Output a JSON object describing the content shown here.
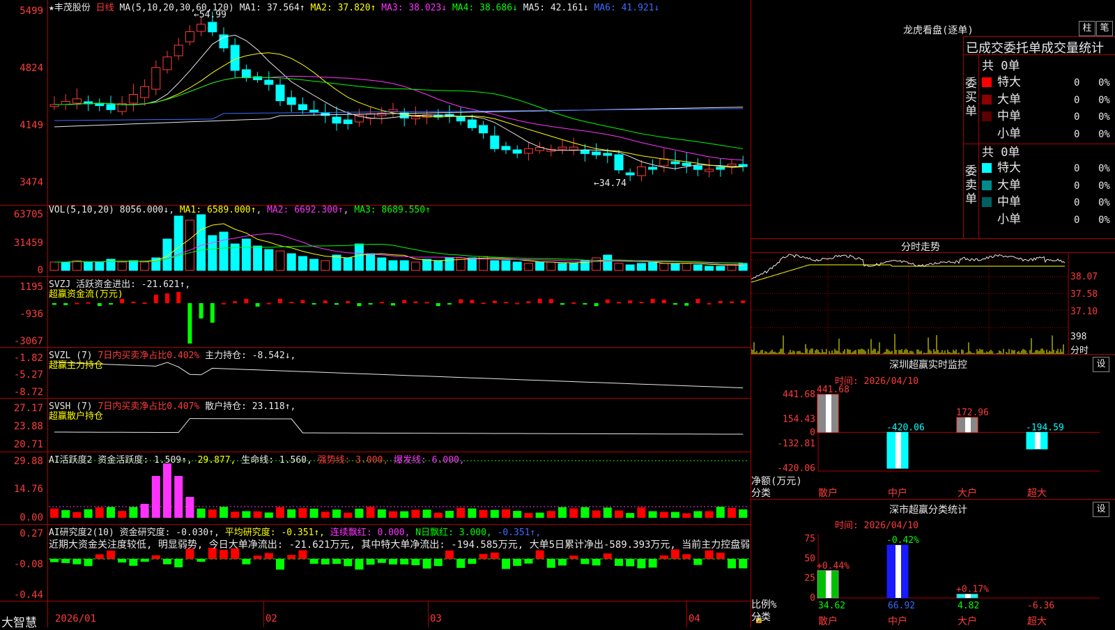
{
  "app": {
    "brand": "大智慧"
  },
  "main_chart": {
    "star": "★",
    "stock_name": "丰茂股份",
    "period": "日线",
    "ma_params": "MA(5,10,20,30,60,120)",
    "ma_values": [
      {
        "label": "MA1: 37.564↑",
        "color": "#e8e8e8"
      },
      {
        "label": "MA2: 37.820↑",
        "color": "#ffff00"
      },
      {
        "label": "MA3: 38.023↓",
        "color": "#ff33ff"
      },
      {
        "label": "MA4: 38.686↓",
        "color": "#00ff00"
      },
      {
        "label": "MA5: 42.161↓",
        "color": "#e8e8e8"
      },
      {
        "label": "MA6: 41.921↓",
        "color": "#3b6cff"
      }
    ],
    "high_label": "54.99",
    "low_label": "34.74",
    "y_ticks": [
      "5499",
      "4824",
      "4149",
      "3474"
    ]
  },
  "vol_panel": {
    "name": "VOL(5,10,20)",
    "value": "8056.000↓",
    "ma1": "MA1: 6589.000↑",
    "ma2": "MA2: 6692.300↑",
    "ma3": "MA3: 8689.550↑",
    "y_ticks": [
      "63705",
      "31459",
      "0"
    ]
  },
  "svzj_panel": {
    "name": "SVZJ",
    "line": "活跃资金进出: -21.621↑,",
    "subtitle": "超赢资金流(万元)",
    "y_ticks": [
      "1195",
      "-936",
      "-3067"
    ]
  },
  "svzl_panel": {
    "name": "SVZL (7)",
    "ratio": "7日内买卖净占比0.402%",
    "holding": "主力持仓: -8.542↓,",
    "subtitle": "超赢主力持仓",
    "y_ticks": [
      "-1.82",
      "-5.27",
      "-8.72"
    ]
  },
  "svsh_panel": {
    "name": "SVSH (7)",
    "ratio": "7日内买卖净占比0.407%",
    "holding": "散户持仓: 23.118↑,",
    "subtitle": "超赢散户持仓",
    "y_ticks": [
      "27.17",
      "23.88",
      "20.71"
    ]
  },
  "ai_active_panel": {
    "name": "AI活跃度2",
    "v1": "资金活跃度: 1.509↑,",
    "v2": "29.877,",
    "v3": "生命线: 1.560,",
    "v4": "强势线: 3.000,",
    "v5": "爆发线: 6.000,",
    "y_ticks": [
      "29.88",
      "14.76",
      "0.00"
    ]
  },
  "ai_research_panel": {
    "name": "AI研究度2(10)",
    "v1": "资金研究度: -0.030↑,",
    "v2": "平均研究度: -0.351↑,",
    "v3": "连续飘红: 0.000,",
    "v4": "N日飘红: 3.000,",
    "v5": "-0.351↑,",
    "comment": "近期大资金关注度较低, 明显弱势, 今日大单净流出: -21.621万元, 其中特大单净流出: -194.585万元, 大单5日累计净出-589.393万元, 当前主力控盘弱",
    "y_ticks": [
      "0.27",
      "-0.08",
      "-0.44"
    ]
  },
  "x_axis": {
    "labels": [
      "2026/01",
      "02",
      "03",
      "04"
    ]
  },
  "lhb": {
    "title": "龙虎看盘(逐单)",
    "btn_bar": "柱",
    "btn_pen": "笔",
    "tabs": "已成交委托单成交量统计",
    "buy_label": "委买单",
    "sell_label": "委卖单",
    "buy_total": "共 0单",
    "sell_total": "共 0单",
    "buy_rows": [
      {
        "name": "特大",
        "count": "0",
        "pct": "0%",
        "color": "#ff0000"
      },
      {
        "name": "大单",
        "count": "0",
        "pct": "0%",
        "color": "#8b0000"
      },
      {
        "name": "中单",
        "count": "0",
        "pct": "0%",
        "color": "#5a0000"
      },
      {
        "name": "小单",
        "count": "0",
        "pct": "0%",
        "color": "#000000"
      }
    ],
    "sell_rows": [
      {
        "name": "特大",
        "count": "0",
        "pct": "0%",
        "color": "#00ffff"
      },
      {
        "name": "大单",
        "count": "0",
        "pct": "0%",
        "color": "#008b8b"
      },
      {
        "name": "中单",
        "count": "0",
        "pct": "0%",
        "color": "#006060"
      },
      {
        "name": "小单",
        "count": "0",
        "pct": "0%",
        "color": "#000000"
      }
    ]
  },
  "intraday": {
    "title": "分时走势",
    "y_ticks": [
      "38.07",
      "37.58",
      "37.10"
    ],
    "vol_tick": "398",
    "vol_unit": "分时"
  },
  "sz_monitor": {
    "title": "深圳超赢实时监控",
    "btn": "设",
    "time": "时间: 2026/04/10",
    "y_label_1": "净额(万元)",
    "y_label_2": "分类",
    "y_ticks": [
      "441.68",
      "154.43",
      "0",
      "-132.81",
      "-420.06"
    ],
    "bars": [
      {
        "cat": "散户",
        "value": 441.68,
        "label": "441.68"
      },
      {
        "cat": "中户",
        "value": -420.06,
        "label": "-420.06"
      },
      {
        "cat": "大户",
        "value": 172.96,
        "label": "172.96"
      },
      {
        "cat": "超大",
        "value": -194.59,
        "label": "-194.59"
      }
    ]
  },
  "sz_class": {
    "title": "深市超赢分类统计",
    "btn": "设",
    "time": "时间: 2026/04/10",
    "y_label_1": "比例%",
    "y_label_2": "分类",
    "y_ticks": [
      "75",
      "50",
      "25",
      "0"
    ],
    "bars": [
      {
        "cat": "散户",
        "value": 34.62,
        "label": "34.62",
        "chg": "+0.44%"
      },
      {
        "cat": "中户",
        "value": 66.92,
        "label": "66.92",
        "chg": "-0.42%"
      },
      {
        "cat": "大户",
        "value": 4.82,
        "label": "4.82",
        "chg": "+0.17%"
      },
      {
        "cat": "超大",
        "value": -6.36,
        "label": "-6.36",
        "chg": ""
      }
    ]
  },
  "chart_data": [
    {
      "type": "bar",
      "title": "深圳超赢实时监控",
      "categories": [
        "散户",
        "中户",
        "大户",
        "超大"
      ],
      "values": [
        441.68,
        -420.06,
        172.96,
        -194.59
      ],
      "ylabel": "净额(万元)",
      "ylim": [
        -420.06,
        441.68
      ]
    },
    {
      "type": "bar",
      "title": "深市超赢分类统计",
      "categories": [
        "散户",
        "中户",
        "大户",
        "超大"
      ],
      "values": [
        34.62,
        66.92,
        4.82,
        -6.36
      ],
      "ylabel": "比例%",
      "ylim": [
        0,
        75
      ]
    }
  ],
  "colors": {
    "up": "#ff3b3b",
    "down": "#00ffff",
    "grid": "#b00000",
    "bg": "#000000"
  }
}
